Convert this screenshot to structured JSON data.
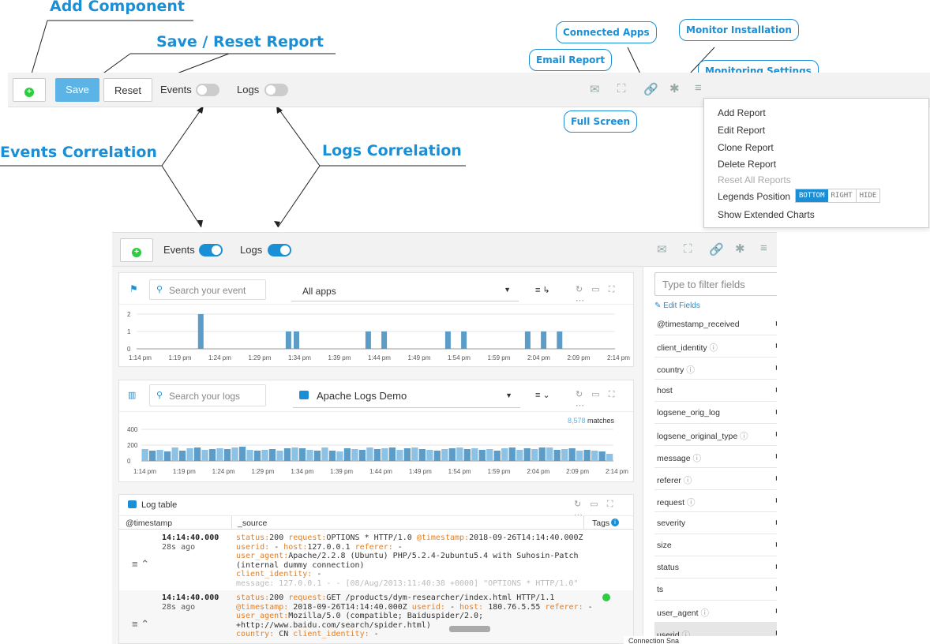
{
  "callouts": {
    "add_component": "Add Component",
    "save_reset": "Save / Reset Report",
    "events_corr": "Events Correlation",
    "logs_corr": "Logs Correlation",
    "email_report": "Email Report",
    "connected_apps": "Connected Apps",
    "full_screen": "Full Screen",
    "monitor_install": "Monitor Installation",
    "monitoring_settings": "Monitoring Settings"
  },
  "toolbar": {
    "save": "Save",
    "reset": "Reset",
    "events": "Events",
    "logs": "Logs"
  },
  "menu": {
    "add": "Add Report",
    "edit": "Edit Report",
    "clone": "Clone Report",
    "delete": "Delete Report",
    "reset_all": "Reset All Reports",
    "legends": "Legends Position",
    "pos_bottom": "BOTTOM",
    "pos_right": "RIGHT",
    "pos_hide": "HIDE",
    "extended": "Show Extended Charts"
  },
  "toolbar2": {
    "events": "Events",
    "logs": "Logs"
  },
  "events_panel": {
    "search_placeholder": "Search your event",
    "apps": "All apps",
    "y_ticks": [
      "2",
      "1",
      "0"
    ],
    "x_ticks": [
      "1:14 pm",
      "1:19 pm",
      "1:24 pm",
      "1:29 pm",
      "1:34 pm",
      "1:39 pm",
      "1:44 pm",
      "1:49 pm",
      "1:54 pm",
      "1:59 pm",
      "2:04 pm",
      "2:09 pm",
      "2:14 pm"
    ]
  },
  "logs_panel": {
    "search_placeholder": "Search your logs",
    "app": "Apache Logs Demo",
    "matches_count": "8,578",
    "matches_label": "matches",
    "y_ticks": [
      "400",
      "200",
      "0"
    ],
    "x_ticks": [
      "1:14 pm",
      "1:19 pm",
      "1:24 pm",
      "1:29 pm",
      "1:34 pm",
      "1:39 pm",
      "1:44 pm",
      "1:49 pm",
      "1:54 pm",
      "1:59 pm",
      "2:04 pm",
      "2:09 pm",
      "2:14 pm"
    ]
  },
  "log_table": {
    "title": "Log table",
    "col_ts": "@timestamp",
    "col_source": "_source",
    "col_tags": "Tags",
    "rows": [
      {
        "time": "14:14:40.000",
        "ago": "28s ago",
        "l1k1": "status:",
        "l1v1": "200",
        "l1k2": "request:",
        "l1v2": "OPTIONS * HTTP/1.0",
        "l1k3": "@timestamp:",
        "l1v3": "2018-09-26T14:14:40.000Z",
        "l2k1": "userid:",
        "l2v1": "-",
        "l2k2": "host:",
        "l2v2": "127.0.0.1",
        "l2k3": "referer:",
        "l2v3": "-",
        "l3k1": "user_agent:",
        "l3v1": "Apache/2.2.8 (Ubuntu) PHP/5.2.4-2ubuntu5.4 with Suhosin-Patch",
        "l4": "(internal dummy connection)",
        "l5k1": "client_identity:",
        "l5v1": "-",
        "l6": "message: 127.0.0.1 - - [08/Aug/2013:11:40:38 +0000] \"OPTIONS * HTTP/1.0\""
      },
      {
        "time": "14:14:40.000",
        "ago": "28s ago",
        "l1k1": "status:",
        "l1v1": "200",
        "l1k2": "request:",
        "l1v2": "GET /products/dym-researcher/index.html HTTP/1.1",
        "l2k1": "@timestamp:",
        "l2v1": "2018-09-26T14:14:40.000Z",
        "l2k2": "userid:",
        "l2v2": "-",
        "l2k3": "host:",
        "l2v3": "180.76.5.55",
        "l2k4": "referer:",
        "l2v4": "-",
        "l3k1": "user_agent:",
        "l3v1": "Mozilla/5.0 (compatible; Baiduspider/2.0;",
        "l4": "+http://www.baidu.com/search/spider.html)",
        "l5k1": "country:",
        "l5v1": "CN",
        "l5k2": "client_identity:",
        "l5v2": "-"
      }
    ]
  },
  "fields_panel": {
    "filter_placeholder": "Type to filter fields",
    "edit": "Edit Fields",
    "items": [
      "@timestamp_received",
      "client_identity",
      "country",
      "host",
      "logsene_orig_log",
      "logsene_original_type",
      "message",
      "referer",
      "request",
      "severity",
      "size",
      "status",
      "ts",
      "user_agent",
      "userid"
    ],
    "info_flags": [
      false,
      true,
      true,
      false,
      false,
      true,
      true,
      true,
      true,
      false,
      false,
      false,
      false,
      true,
      true
    ]
  },
  "bottom_panel": {
    "title": "Connection Sna"
  },
  "colors": {
    "accent": "#1a8fd6",
    "save": "#5bb4e5",
    "bar": "#5b9cc8",
    "green": "#2ecc40",
    "key": "#e67e22"
  },
  "chart_data": [
    {
      "type": "bar",
      "title": "",
      "series": [
        {
          "values": [
            0,
            0,
            0,
            0,
            0,
            0,
            0,
            0,
            0,
            0,
            0,
            0,
            0,
            0,
            0,
            0,
            0,
            0,
            0,
            0,
            0,
            0,
            0,
            0,
            0,
            0,
            0,
            0,
            0,
            0,
            0,
            0,
            0,
            0,
            0,
            0,
            0,
            0,
            0,
            0,
            0,
            0,
            0,
            0,
            0,
            0,
            0,
            0,
            0,
            0,
            0,
            0,
            0,
            0,
            0,
            0,
            0,
            0,
            0,
            0,
            0,
            0
          ]
        }
      ],
      "events": [
        {
          "x": "1:22 pm",
          "y": 2
        },
        {
          "x": "1:33 pm",
          "y": 1
        },
        {
          "x": "1:34 pm",
          "y": 1
        },
        {
          "x": "1:43 pm",
          "y": 1
        },
        {
          "x": "1:45 pm",
          "y": 1
        },
        {
          "x": "1:53 pm",
          "y": 1
        },
        {
          "x": "1:55 pm",
          "y": 1
        },
        {
          "x": "2:03 pm",
          "y": 1
        },
        {
          "x": "2:05 pm",
          "y": 1
        },
        {
          "x": "2:07 pm",
          "y": 1
        }
      ],
      "ylim": [
        0,
        2
      ]
    },
    {
      "type": "bar",
      "title": "",
      "values": [
        150,
        130,
        140,
        120,
        170,
        130,
        160,
        170,
        140,
        150,
        160,
        150,
        170,
        180,
        140,
        130,
        140,
        150,
        130,
        160,
        170,
        160,
        140,
        130,
        170,
        130,
        120,
        160,
        150,
        140,
        170,
        150,
        160,
        170,
        140,
        160,
        170,
        150,
        140,
        130,
        150,
        160,
        170,
        150,
        160,
        140,
        150,
        130,
        160,
        170,
        140,
        160,
        150,
        170,
        170,
        140,
        150,
        160,
        130,
        140,
        130,
        120,
        90
      ],
      "ylim": [
        0,
        400
      ]
    }
  ]
}
